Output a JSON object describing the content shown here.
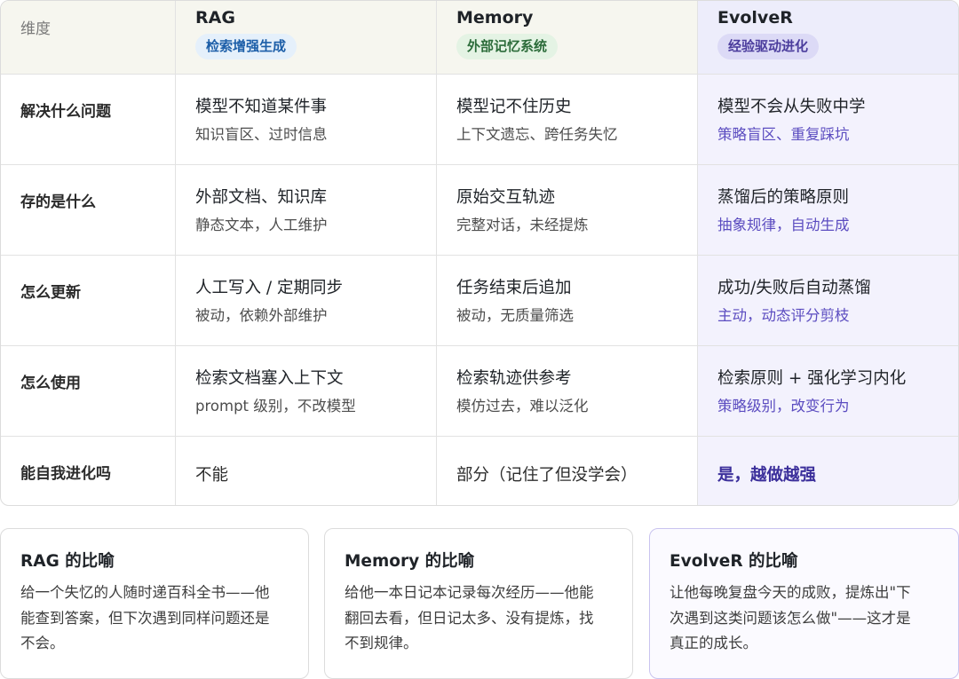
{
  "table": {
    "header": {
      "dimension": "维度",
      "columns": [
        {
          "name": "RAG",
          "tag": "检索增强生成"
        },
        {
          "name": "Memory",
          "tag": "外部记忆系统"
        },
        {
          "name": "EvolveR",
          "tag": "经验驱动进化"
        }
      ]
    },
    "rows": [
      {
        "label": "解决什么问题",
        "cells": [
          {
            "main": "模型不知道某件事",
            "sub": "知识盲区、过时信息"
          },
          {
            "main": "模型记不住历史",
            "sub": "上下文遗忘、跨任务失忆"
          },
          {
            "main": "模型不会从失败中学",
            "sub": "策略盲区、重复踩坑"
          }
        ]
      },
      {
        "label": "存的是什么",
        "cells": [
          {
            "main": "外部文档、知识库",
            "sub": "静态文本，人工维护"
          },
          {
            "main": "原始交互轨迹",
            "sub": "完整对话，未经提炼"
          },
          {
            "main": "蒸馏后的策略原则",
            "sub": "抽象规律，自动生成"
          }
        ]
      },
      {
        "label": "怎么更新",
        "cells": [
          {
            "main": "人工写入 / 定期同步",
            "sub": "被动，依赖外部维护"
          },
          {
            "main": "任务结束后追加",
            "sub": "被动，无质量筛选"
          },
          {
            "main": "成功/失败后自动蒸馏",
            "sub": "主动，动态评分剪枝"
          }
        ]
      },
      {
        "label": "怎么使用",
        "cells": [
          {
            "main": "检索文档塞入上下文",
            "sub": "prompt 级别，不改模型"
          },
          {
            "main": "检索轨迹供参考",
            "sub": "模仿过去，难以泛化"
          },
          {
            "main": "检索原则 + 强化学习内化",
            "sub": "策略级别，改变行为"
          }
        ]
      },
      {
        "label": "能自我进化吗",
        "cells": [
          {
            "main": "不能"
          },
          {
            "main": "部分（记住了但没学会）"
          },
          {
            "main": "是，越做越强"
          }
        ]
      }
    ]
  },
  "cards": [
    {
      "title": "RAG 的比喻",
      "body": [
        "给一个失忆的人随时递百科全书——他",
        "能查到答案，但下次遇到同样问题还是",
        "不会。"
      ]
    },
    {
      "title": "Memory 的比喻",
      "body": [
        "给他一本日记本记录每次经历——他能",
        "翻回去看，但日记太多、没有提炼，找",
        "不到规律。"
      ]
    },
    {
      "title": "EvolveR 的比喻",
      "body": [
        "让他每晚复盘今天的成败，提炼出\"下",
        "次遇到这类问题该怎么做\"——这才是",
        "真正的成长。"
      ]
    }
  ]
}
